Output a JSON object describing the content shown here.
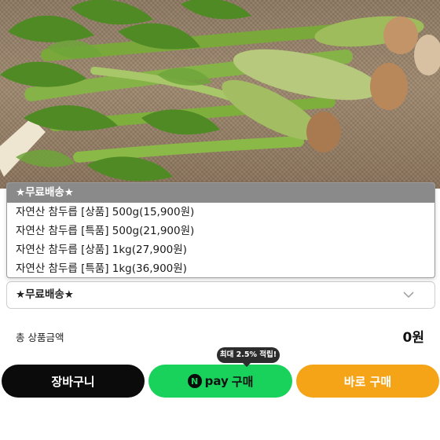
{
  "product": {
    "image_icon": "fatsia-shoots-photo"
  },
  "options": {
    "selected_label": "★무료배송★",
    "list": [
      "★무료배송★",
      "자연산 참두릅 [상품] 500g(15,900원)",
      "자연산 참두릅 [특품] 500g(21,900원)",
      "자연산 참두릅 [상품] 1kg(27,900원)",
      "자연산 참두릅 [특품] 1kg(36,900원)"
    ]
  },
  "select": {
    "value": "★무료배송★",
    "icon": "chevron-down-icon"
  },
  "total": {
    "label": "총 상품금액",
    "value": "0원"
  },
  "npay_tooltip": "최대 2.5% 적립!",
  "buttons": {
    "cart": "장바구니",
    "npay_logo": "N",
    "npay_word": "pay",
    "npay_label": "구매",
    "buy_now": "바로 구매"
  },
  "colors": {
    "cart_button": "#0b0b0b",
    "npay_button": "#19d25c",
    "buy_button": "#f5a417",
    "selected_option": "#8a8a8a"
  }
}
